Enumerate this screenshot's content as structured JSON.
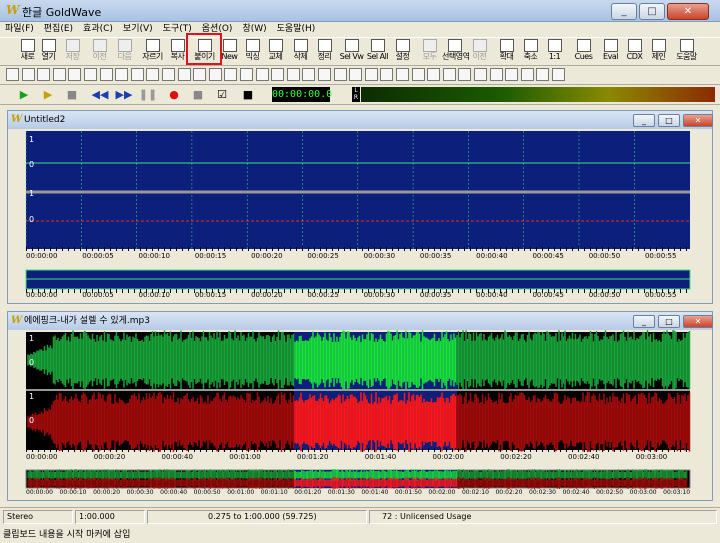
{
  "app": {
    "title": "한글 GoldWave",
    "logo": "W"
  },
  "caption_buttons": [
    "_",
    "□",
    "✕"
  ],
  "menu": [
    "파일(F)",
    "편집(E)",
    "효과(C)",
    "보기(V)",
    "도구(T)",
    "옵션(O)",
    "창(W)",
    "도움말(H)"
  ],
  "toolbar1": [
    {
      "label": "새로",
      "icon": "new-file-icon",
      "state": "enabled"
    },
    {
      "label": "열기",
      "icon": "open-folder-icon",
      "state": "enabled"
    },
    {
      "label": "저장",
      "icon": "save-icon",
      "state": "disabled"
    },
    {
      "label": "이전",
      "icon": "undo-icon",
      "state": "disabled"
    },
    {
      "label": "다음",
      "icon": "redo-icon",
      "state": "disabled"
    },
    {
      "label": "자르기",
      "icon": "cut-icon",
      "state": "enabled"
    },
    {
      "label": "복사",
      "icon": "copy-icon",
      "state": "enabled"
    },
    {
      "label": "붙이기",
      "icon": "paste-icon",
      "state": "enabled"
    },
    {
      "label": "New",
      "icon": "paste-new-icon",
      "state": "enabled"
    },
    {
      "label": "믹싱",
      "icon": "mix-icon",
      "state": "enabled"
    },
    {
      "label": "교체",
      "icon": "replace-icon",
      "state": "enabled"
    },
    {
      "label": "삭제",
      "icon": "delete-icon",
      "state": "enabled"
    },
    {
      "label": "정리",
      "icon": "trim-icon",
      "state": "enabled"
    },
    {
      "label": "Sel Vw",
      "icon": "select-view-icon",
      "state": "enabled"
    },
    {
      "label": "Sel All",
      "icon": "select-all-icon",
      "state": "enabled"
    },
    {
      "label": "설정",
      "icon": "settings-icon",
      "state": "enabled"
    },
    {
      "label": "모두",
      "icon": "zoom-all-icon",
      "state": "disabled"
    },
    {
      "label": "선택영역",
      "icon": "zoom-selection-icon",
      "state": "enabled"
    },
    {
      "label": "이전",
      "icon": "zoom-prev-icon",
      "state": "disabled"
    },
    {
      "label": "확대",
      "icon": "zoom-in-icon",
      "state": "enabled"
    },
    {
      "label": "축소",
      "icon": "zoom-out-icon",
      "state": "enabled"
    },
    {
      "label": "1:1",
      "icon": "zoom-1to1-icon",
      "state": "enabled"
    },
    {
      "label": "Cues",
      "icon": "cues-icon",
      "state": "enabled"
    },
    {
      "label": "Eval",
      "icon": "eval-icon",
      "state": "enabled"
    },
    {
      "label": "CDX",
      "icon": "cd-icon",
      "state": "enabled"
    },
    {
      "label": "제인",
      "icon": "help-icon",
      "state": "enabled"
    },
    {
      "label": "도움말",
      "icon": "book-icon",
      "state": "enabled"
    }
  ],
  "toolbar2_count": 36,
  "transport": {
    "buttons": [
      "▶",
      "▶",
      "■",
      "⏺",
      "◀◀",
      "▶▶",
      "❚❚",
      "●",
      "■",
      "☑",
      "■"
    ],
    "counter": "00:00:00.0",
    "level_lr": "L R"
  },
  "window1": {
    "title": "Untitled2",
    "channel_labels": [
      "1",
      "0",
      "1",
      "0"
    ],
    "times": [
      "00:00:00",
      "00:00:05",
      "00:00:10",
      "00:00:15",
      "00:00:20",
      "00:00:25",
      "00:00:30",
      "00:00:35",
      "00:00:40",
      "00:00:45",
      "00:00:50",
      "00:00:55"
    ]
  },
  "window2": {
    "title": "에에핑크-내가 설렐 수 있게.mp3",
    "channel_labels": [
      "1",
      "0",
      "1",
      "0"
    ],
    "times": [
      "00:00:00",
      "00:00:20",
      "00:00:40",
      "00:01:00",
      "00:01:20",
      "00:01:40",
      "00:02:00",
      "00:02:20",
      "00:02:40",
      "00:03:00"
    ],
    "overview_times": [
      "00:00:00",
      "00:00:10",
      "00:00:20",
      "00:00:30",
      "00:00:40",
      "00:00:50",
      "00:01:00",
      "00:01:10",
      "00:01:20",
      "00:01:30",
      "00:01:40",
      "00:01:50",
      "00:02:00",
      "00:02:10",
      "00:02:20",
      "00:02:30",
      "00:02:40",
      "00:02:50",
      "00:03:00",
      "00:03:10"
    ]
  },
  "statusbar": {
    "mode": "Stereo",
    "zoom": "1:00.000",
    "selection": "0.275 to 1:00.000 (59.725)",
    "license": "72 : Unlicensed Usage",
    "message": "클립보드 내용을 시작 마커에 삽입"
  },
  "colors": {
    "wave_bg": "#0c1f7a",
    "grid": "#3fe08a",
    "wave_green": "#18a23a",
    "wave_green_sel": "#18e038",
    "wave_red": "#a30b0b",
    "wave_red_sel": "#ff1717",
    "highlight": "#e0121f"
  }
}
